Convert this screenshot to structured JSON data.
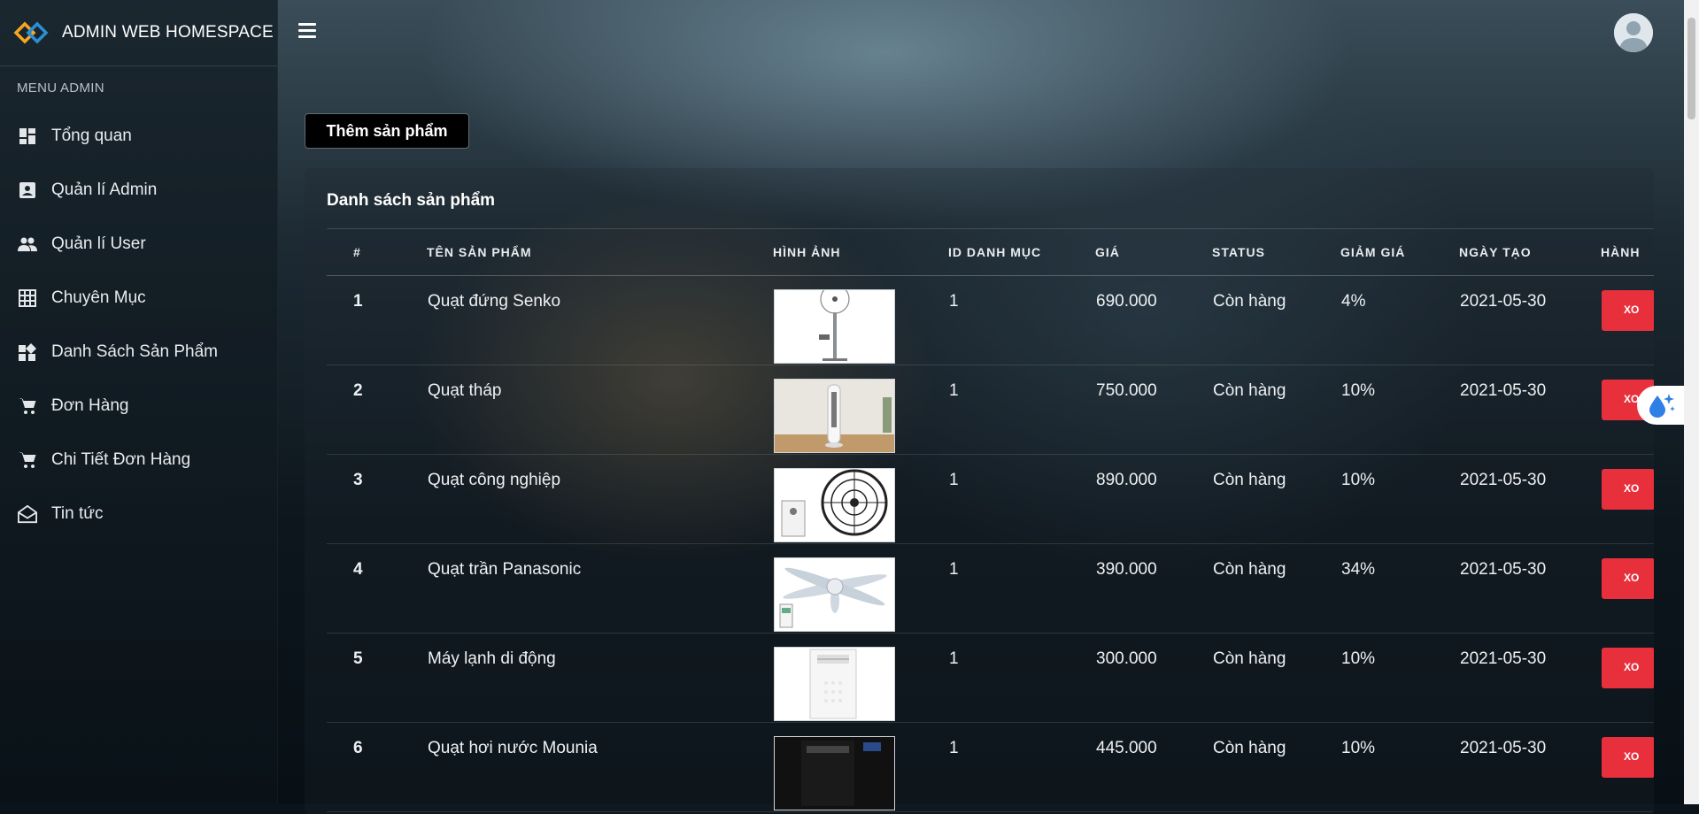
{
  "brand": {
    "name": "ADMIN WEB HOMESPACE"
  },
  "sidebar": {
    "title": "MENU ADMIN",
    "items": [
      {
        "label": "Tổng quan",
        "icon": "dashboard-icon"
      },
      {
        "label": "Quản lí Admin",
        "icon": "contact-card-icon"
      },
      {
        "label": "Quản lí User",
        "icon": "users-icon"
      },
      {
        "label": "Chuyên Mục",
        "icon": "grid-icon"
      },
      {
        "label": "Danh Sách Sản Phẩm",
        "icon": "widgets-icon"
      },
      {
        "label": "Đơn Hàng",
        "icon": "cart-icon"
      },
      {
        "label": "Chi Tiết Đơn Hàng",
        "icon": "cart-icon"
      },
      {
        "label": "Tin tức",
        "icon": "mail-open-icon"
      }
    ]
  },
  "toolbar": {
    "add_label": "Thêm sản phẩm"
  },
  "card": {
    "title": "Danh sách sản phẩm"
  },
  "table": {
    "headers": [
      "#",
      "TÊN SẢN PHẨM",
      "HÌNH ẢNH",
      "ID DANH MỤC",
      "GIÁ",
      "STATUS",
      "GIẢM GIÁ",
      "NGÀY TẠO",
      "HÀNH"
    ],
    "rows": [
      {
        "id": "1",
        "name": "Quạt đứng Senko",
        "image": "standing-fan",
        "cat": "1",
        "price": "690.000",
        "status": "Còn hàng",
        "discount": "4%",
        "date": "2021-05-30",
        "action": "XO"
      },
      {
        "id": "2",
        "name": "Quạt tháp",
        "image": "tower-fan",
        "cat": "1",
        "price": "750.000",
        "status": "Còn hàng",
        "discount": "10%",
        "date": "2021-05-30",
        "action": "XO"
      },
      {
        "id": "3",
        "name": "Quạt công nghiệp",
        "image": "industrial-fan",
        "cat": "1",
        "price": "890.000",
        "status": "Còn hàng",
        "discount": "10%",
        "date": "2021-05-30",
        "action": "XO"
      },
      {
        "id": "4",
        "name": "Quạt trần Panasonic",
        "image": "ceiling-fan",
        "cat": "1",
        "price": "390.000",
        "status": "Còn hàng",
        "discount": "34%",
        "date": "2021-05-30",
        "action": "XO"
      },
      {
        "id": "5",
        "name": "Máy lạnh di động",
        "image": "portable-ac",
        "cat": "1",
        "price": "300.000",
        "status": "Còn hàng",
        "discount": "10%",
        "date": "2021-05-30",
        "action": "XO"
      },
      {
        "id": "6",
        "name": "Quạt hơi nước Mounia",
        "image": "evaporative-fan",
        "cat": "1",
        "price": "445.000",
        "status": "Còn hàng",
        "discount": "10%",
        "date": "2021-05-30",
        "action": "XO"
      }
    ]
  }
}
